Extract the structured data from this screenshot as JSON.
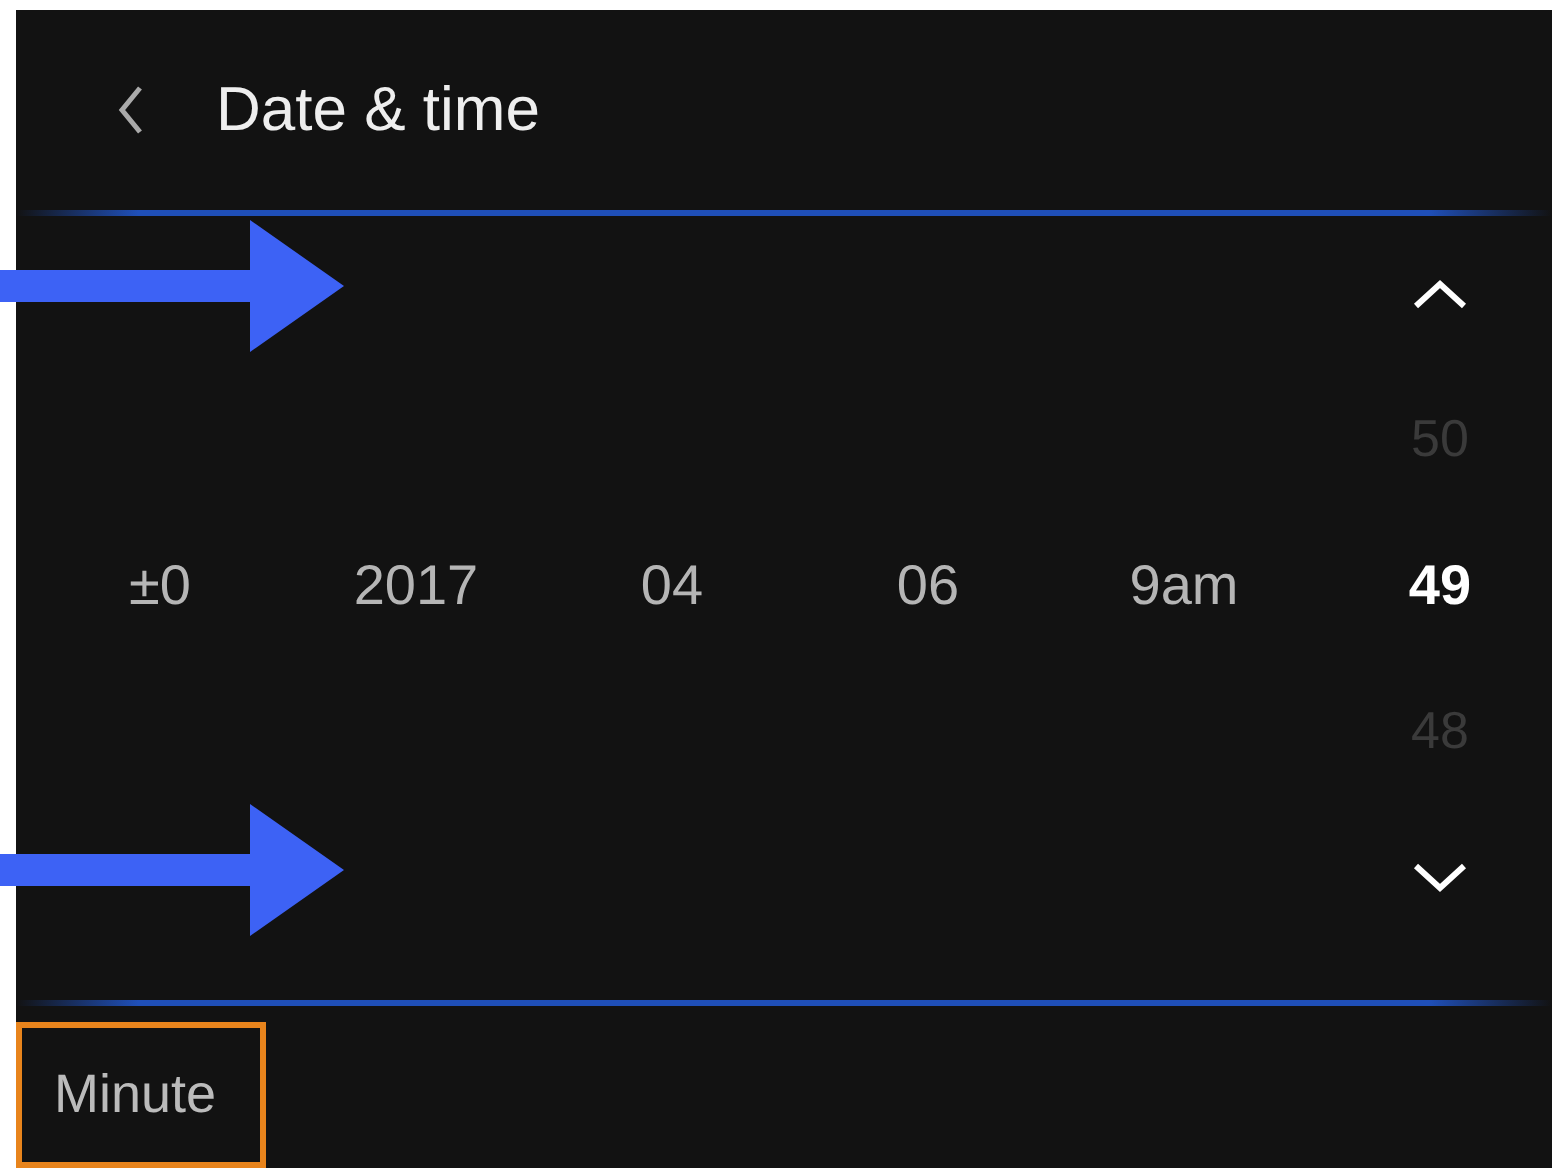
{
  "header": {
    "title": "Date & time"
  },
  "fields": [
    {
      "value": "±0",
      "selected": false
    },
    {
      "value": "2017",
      "selected": false
    },
    {
      "value": "04",
      "selected": false
    },
    {
      "value": "06",
      "selected": false
    },
    {
      "value": "9am",
      "selected": false
    },
    {
      "value": "49",
      "selected": true
    }
  ],
  "spinner": {
    "above": "50",
    "below": "48"
  },
  "field_label": {
    "text": "Minute",
    "focused": true
  }
}
